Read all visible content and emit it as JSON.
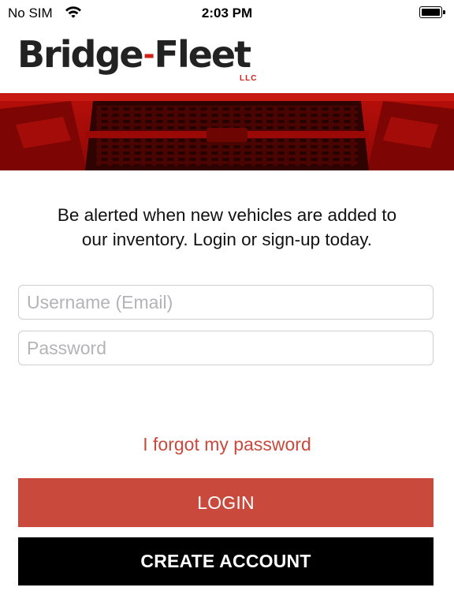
{
  "status_bar": {
    "carrier": "No SIM",
    "time": "2:03 PM"
  },
  "brand": {
    "word1": "Bridge",
    "separator": "-",
    "word2": "Fleet",
    "suffix": "LLC",
    "accent_color": "#d2201c"
  },
  "banner": {
    "icon": "truck-grille-image"
  },
  "tagline": {
    "line1": "Be alerted when new vehicles are added to",
    "line2": "our inventory.  Login or sign-up today."
  },
  "form": {
    "username_placeholder": "Username (Email)",
    "username_value": "",
    "password_placeholder": "Password",
    "password_value": ""
  },
  "links": {
    "forgot_password": "I forgot my password"
  },
  "buttons": {
    "login": "LOGIN",
    "create_account": "CREATE ACCOUNT",
    "login_color": "#c94a3c",
    "create_color": "#000000"
  }
}
